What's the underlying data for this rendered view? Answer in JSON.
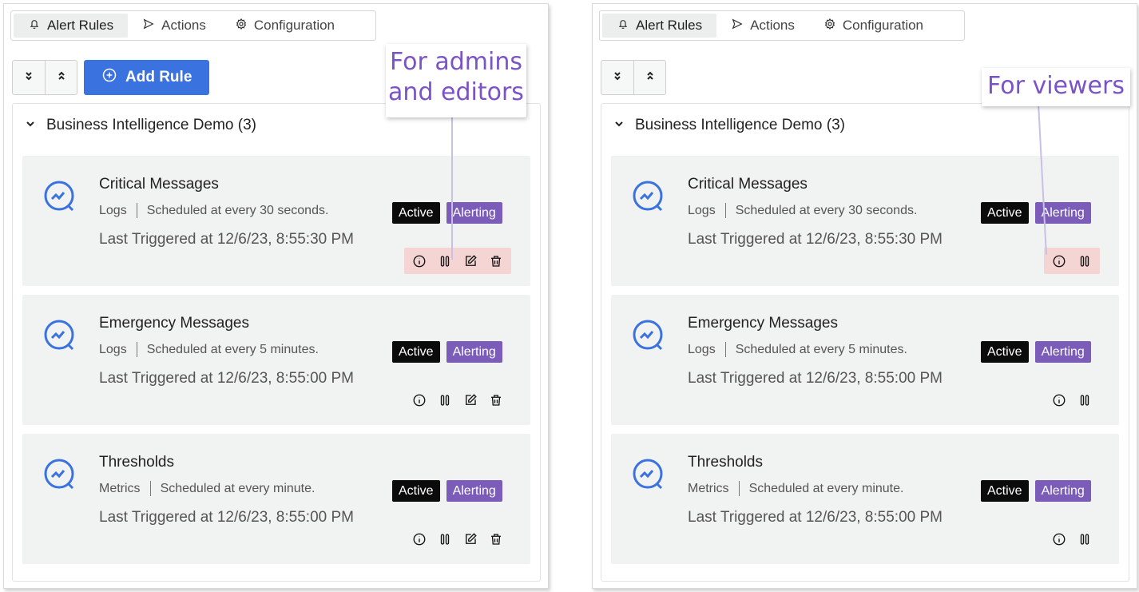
{
  "tabs": [
    {
      "label": "Alert Rules",
      "icon": "bell-icon"
    },
    {
      "label": "Actions",
      "icon": "send-icon"
    },
    {
      "label": "Configuration",
      "icon": "gear-icon"
    }
  ],
  "toolbar": {
    "add_rule_label": "Add Rule"
  },
  "group": {
    "title": "Business Intelligence Demo (3)"
  },
  "rules": [
    {
      "name": "Critical Messages",
      "type": "Logs",
      "schedule": "Scheduled at every 30 seconds.",
      "last_triggered": "Last Triggered at 12/6/23, 8:55:30 PM",
      "status": "Active",
      "state": "Alerting"
    },
    {
      "name": "Emergency Messages",
      "type": "Logs",
      "schedule": "Scheduled at every 5 minutes.",
      "last_triggered": "Last Triggered at 12/6/23, 8:55:00 PM",
      "status": "Active",
      "state": "Alerting"
    },
    {
      "name": "Thresholds",
      "type": "Metrics",
      "schedule": "Scheduled at every minute.",
      "last_triggered": "Last Triggered at 12/6/23, 8:55:00 PM",
      "status": "Active",
      "state": "Alerting"
    }
  ],
  "callouts": {
    "admins": [
      "For admins",
      "and editors"
    ],
    "viewers": "For viewers"
  },
  "colors": {
    "accent": "#3a73e0",
    "alerting": "#7b5cb8",
    "active": "#0b0b0b",
    "highlight": "#f5d5d3",
    "callout_text": "#7a53c9"
  }
}
